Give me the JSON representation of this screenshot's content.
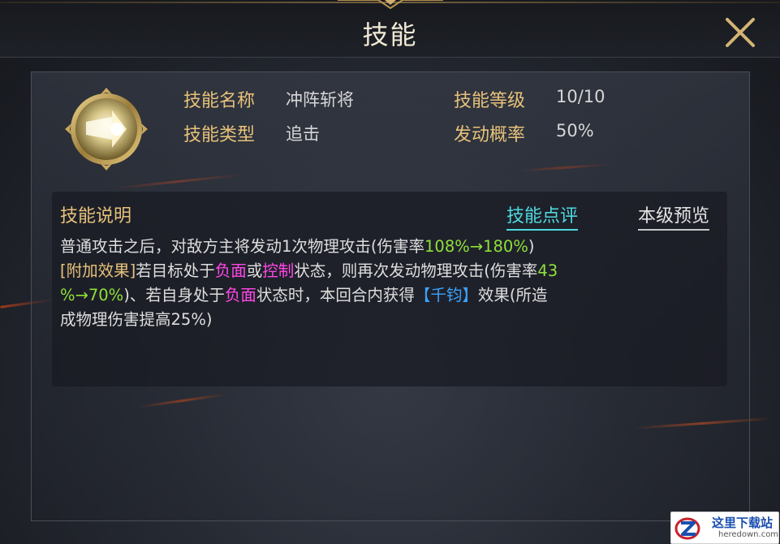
{
  "header": {
    "title": "技能"
  },
  "skill": {
    "name_label": "技能名称",
    "name_value": "冲阵斩将",
    "level_label": "技能等级",
    "level_value": "10/10",
    "type_label": "技能类型",
    "type_value": "追击",
    "chance_label": "发动概率",
    "chance_value": "50%"
  },
  "description": {
    "title": "技能说明",
    "review_tab": "技能点评",
    "preview_tab": "本级预览",
    "line1": {
      "a": "普通攻击之后，对敌方主将发动1次物理攻击(伤害率",
      "b": "108%→180%",
      "c": ")"
    },
    "line2": {
      "a": "[附加效果]",
      "b": "若目标处于",
      "c": "负面",
      "d": "或",
      "e": "控制",
      "f": "状态，则再次发动物理攻击(伤害率",
      "g": "43"
    },
    "line3": {
      "a": "%→70%",
      "b": ")、若自身处于",
      "c": "负面",
      "d": "状态时，本回合内获得",
      "e": "【千钧】",
      "f": "效果(所造"
    },
    "line4": {
      "a": "成物理伤害提高25%)"
    }
  },
  "watermark": {
    "name": "这里下载站",
    "url": "heredown.com"
  },
  "colors": {
    "label_gold": "#e8c27a",
    "highlight_green": "#8fe03a",
    "highlight_pink": "#ff48e6",
    "highlight_blue": "#3aa3ff",
    "tab_cyan": "#4ed9e0"
  },
  "icons": [
    "close-icon",
    "skill-emblem-icon",
    "watermark-logo-icon"
  ]
}
